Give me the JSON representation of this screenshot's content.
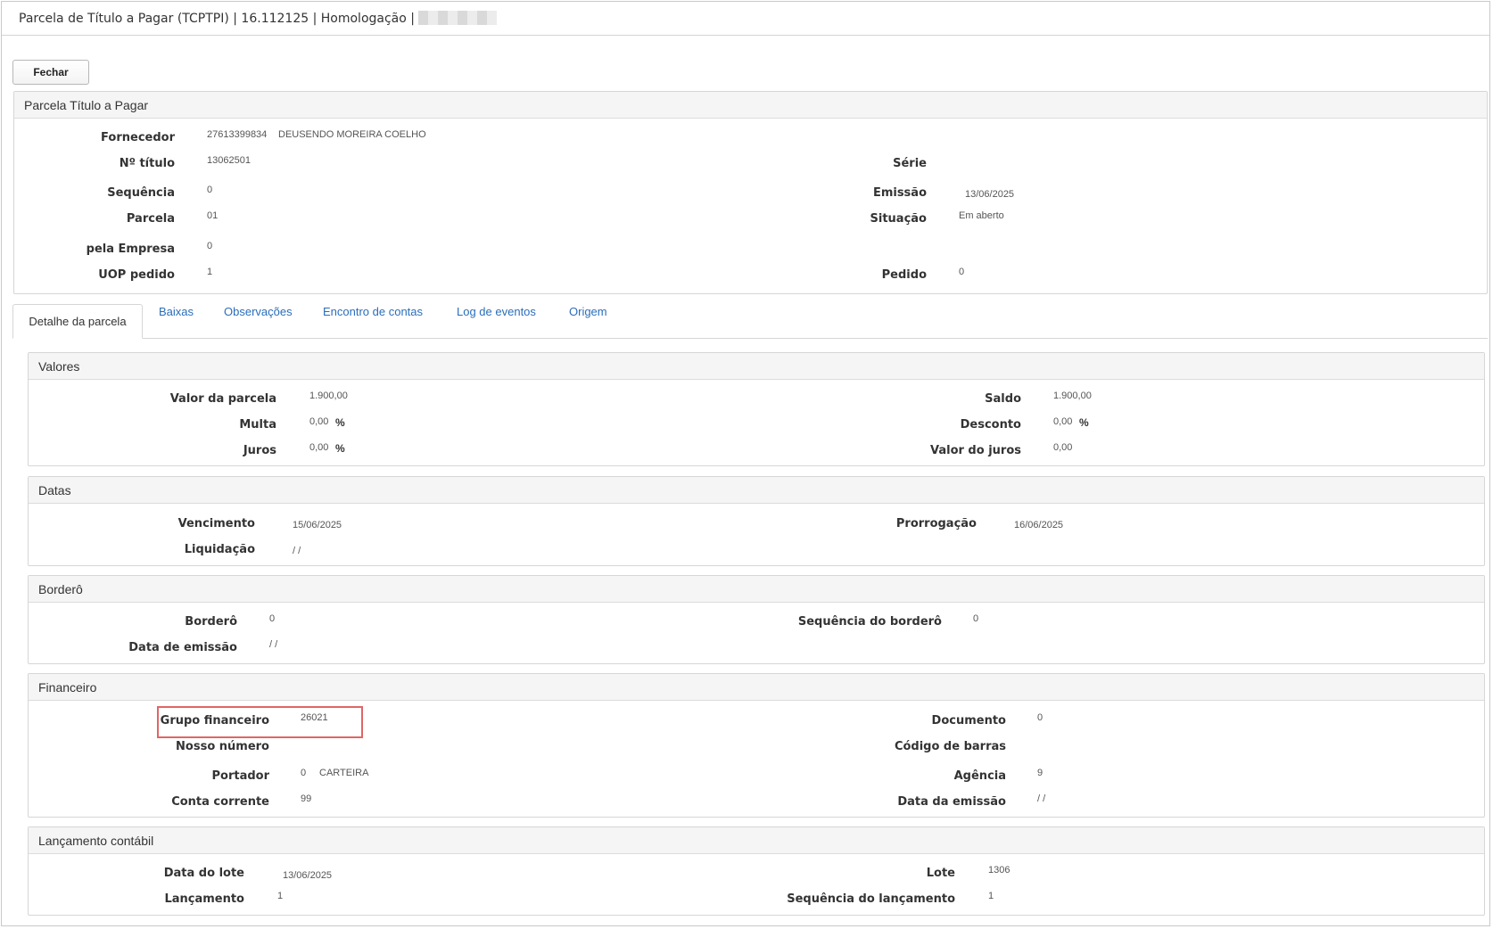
{
  "window": {
    "title": "Parcela de Título a Pagar (TCPTPI) | 16.112125 | Homologação |"
  },
  "toolbar": {
    "close_label": "Fechar"
  },
  "header_panel": {
    "title": "Parcela Título a Pagar",
    "fornecedor_label": "Fornecedor",
    "fornecedor_code": "27613399834",
    "fornecedor_name": "DEUSENDO MOREIRA COELHO",
    "numero_label": "Nº título",
    "numero_value": "13062501",
    "serie_label": "Série",
    "sequencia_label": "Sequência",
    "sequencia_value": "0",
    "emissao_label": "Emissão",
    "emissao_value": "13/06/2025",
    "parcela_label": "Parcela",
    "parcela_value": "01",
    "situacao_label": "Situação",
    "situacao_value": "Em aberto",
    "empresa_label": "pela Empresa",
    "empresa_value": "0",
    "uop_label": "UOP pedido",
    "uop_value": "1",
    "pedido_label": "Pedido",
    "pedido_value": "0"
  },
  "tabs": [
    {
      "label": "Detalhe da parcela",
      "active": true
    },
    {
      "label": "Baixas"
    },
    {
      "label": "Observações"
    },
    {
      "label": "Encontro de contas"
    },
    {
      "label": "Log de eventos"
    },
    {
      "label": "Origem"
    }
  ],
  "valores": {
    "title": "Valores",
    "valor_parcela_label": "Valor da parcela",
    "valor_parcela_value": "1.900,00",
    "saldo_label": "Saldo",
    "saldo_value": "1.900,00",
    "multa_label": "Multa",
    "multa_value": "0,00",
    "desconto_label": "Desconto",
    "desconto_value": "0,00",
    "juros_label": "Juros",
    "juros_value": "0,00",
    "valor_juros_label": "Valor do juros",
    "valor_juros_value": "0,00",
    "percent_symbol": "%"
  },
  "datas": {
    "title": "Datas",
    "vencimento_label": "Vencimento",
    "vencimento_value": "15/06/2025",
    "prorrogacao_label": "Prorrogação",
    "prorrogacao_value": "16/06/2025",
    "liquidacao_label": "Liquidação",
    "liquidacao_value": "/ /"
  },
  "bordero": {
    "title": "Borderô",
    "bordero_label": "Borderô",
    "bordero_value": "0",
    "seq_bordero_label": "Sequência do borderô",
    "seq_bordero_value": "0",
    "data_emissao_label": "Data de emissão",
    "data_emissao_value": "/ /"
  },
  "financeiro": {
    "title": "Financeiro",
    "grupo_label": "Grupo financeiro",
    "grupo_value": "26021",
    "documento_label": "Documento",
    "documento_value": "0",
    "nosso_numero_label": "Nosso número",
    "codigo_barras_label": "Código de barras",
    "portador_label": "Portador",
    "portador_code": "0",
    "portador_name": "CARTEIRA",
    "agencia_label": "Agência",
    "agencia_value": "9",
    "conta_label": "Conta corrente",
    "conta_value": "99",
    "data_emissao_label": "Data da emissão",
    "data_emissao_value": "/ /"
  },
  "lancamento": {
    "title": "Lançamento contábil",
    "data_lote_label": "Data do lote",
    "data_lote_value": "13/06/2025",
    "lote_label": "Lote",
    "lote_value": "1306",
    "lancamento_label": "Lançamento",
    "lancamento_value": "1",
    "seq_lancamento_label": "Sequência do lançamento",
    "seq_lancamento_value": "1"
  }
}
